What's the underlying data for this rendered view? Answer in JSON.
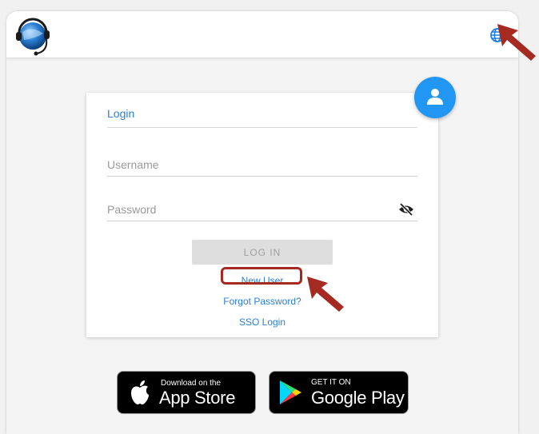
{
  "header": {
    "logo_icon": "headset-globe-logo",
    "language_icon": "globe-icon"
  },
  "avatar": {
    "icon": "user-icon",
    "color": "#2196f3"
  },
  "login_form": {
    "title": "Login",
    "username_placeholder": "Username",
    "username_value": "",
    "password_placeholder": "Password",
    "password_value": "",
    "visibility_icon": "eye-slash-icon",
    "login_button_label": "LOG IN",
    "new_user_link": "New User",
    "forgot_password_link": "Forgot Password?",
    "sso_login_link": "SSO Login"
  },
  "stores": {
    "app_store": {
      "small": "Download on the",
      "big": "App Store"
    },
    "google_play": {
      "small": "GET IT ON",
      "big": "Google Play"
    }
  },
  "colors": {
    "accent": "#2b7fd6",
    "annotation": "#a52a22",
    "button_disabled": "#dedede"
  }
}
